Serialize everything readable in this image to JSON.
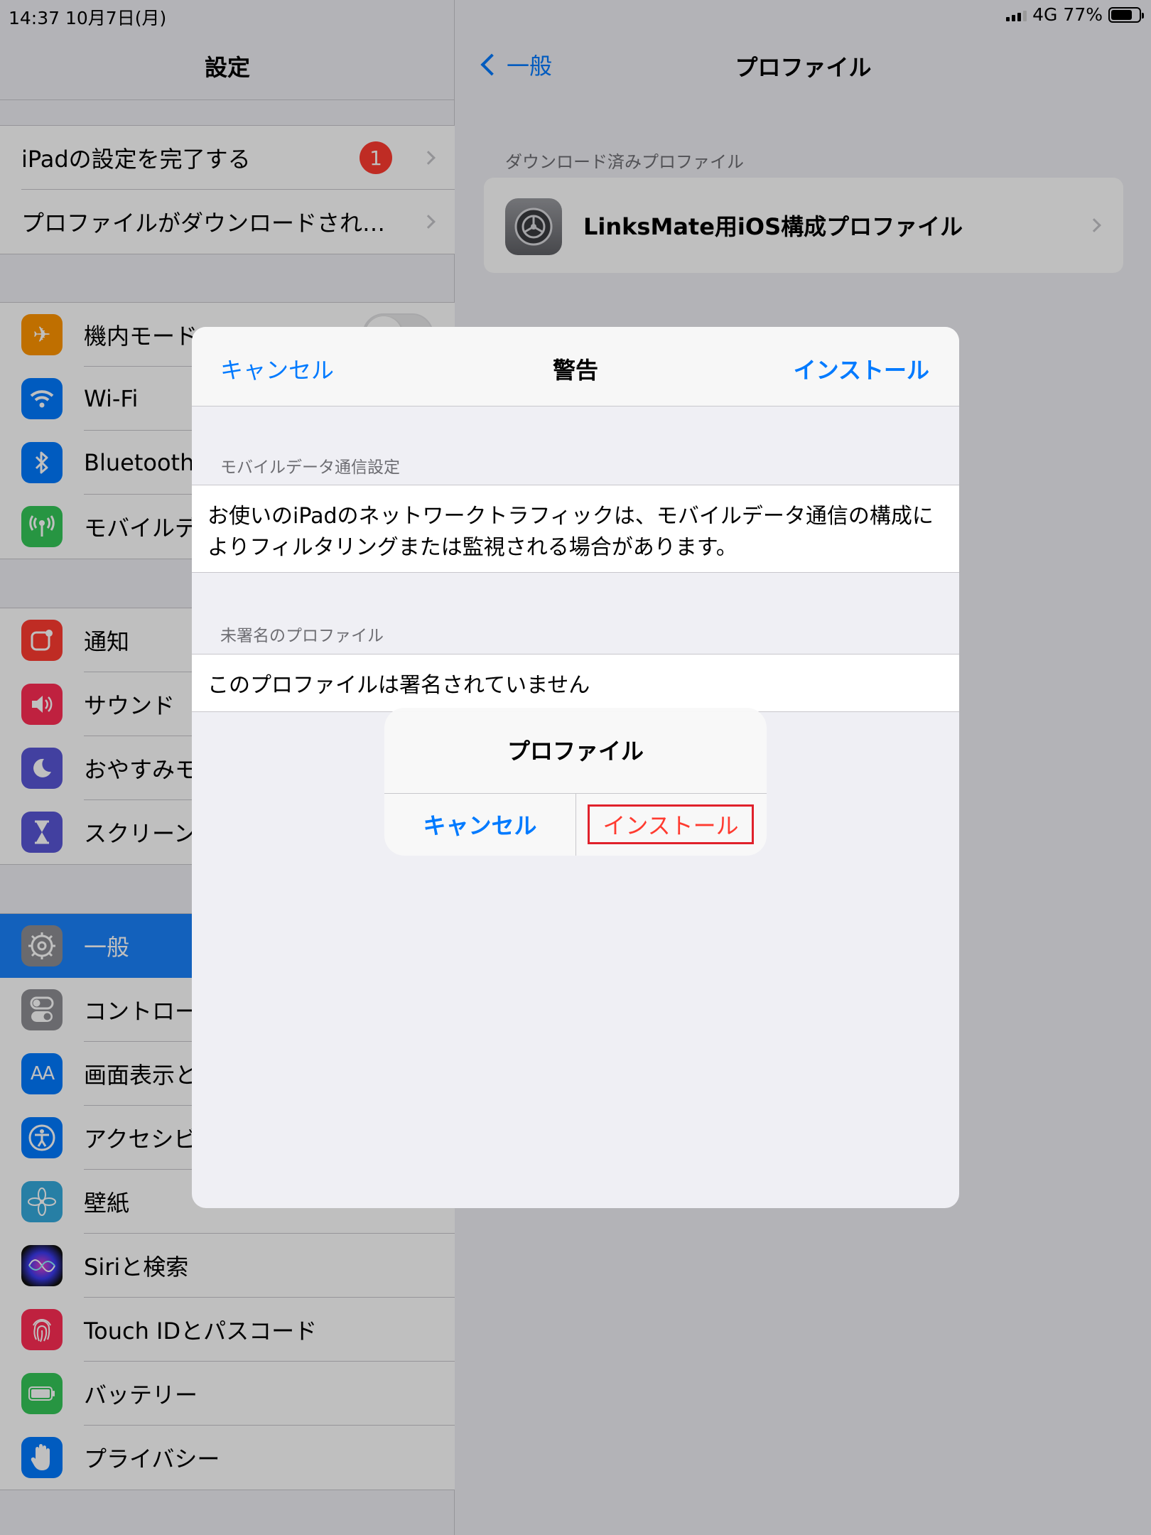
{
  "status_bar": {
    "time_date": "14:37  10月7日(月)",
    "network": "4G",
    "battery": "77%",
    "battery_level": 0.77
  },
  "sidebar": {
    "title": "設定",
    "setup_items": [
      {
        "label": "iPadの設定を完了する",
        "badge": "1"
      },
      {
        "label": "プロファイルがダウンロードされ…"
      }
    ],
    "group1": [
      {
        "label": "機内モード",
        "icon": "airplane-icon",
        "color": "#ff9500"
      },
      {
        "label": "Wi-Fi",
        "icon": "wifi-icon",
        "color": "#007aff"
      },
      {
        "label": "Bluetooth",
        "icon": "bluetooth-icon",
        "color": "#007aff"
      },
      {
        "label": "モバイルデ",
        "icon": "antenna-icon",
        "color": "#34c759"
      }
    ],
    "group2": [
      {
        "label": "通知",
        "icon": "notification-icon",
        "color": "#ff3b30"
      },
      {
        "label": "サウンド",
        "icon": "speaker-icon",
        "color": "#ff2d55"
      },
      {
        "label": "おやすみモ",
        "icon": "moon-icon",
        "color": "#5856d6"
      },
      {
        "label": "スクリーン",
        "icon": "hourglass-icon",
        "color": "#5856d6"
      }
    ],
    "group3": [
      {
        "label": "一般",
        "icon": "gear-icon",
        "color": "#8e8e93",
        "selected": true
      },
      {
        "label": "コントロー",
        "icon": "toggles-icon",
        "color": "#8e8e93"
      },
      {
        "label": "画面表示と",
        "icon": "text-size-icon",
        "color": "#007aff"
      },
      {
        "label": "アクセシビ",
        "icon": "accessibility-icon",
        "color": "#007aff"
      },
      {
        "label": "壁紙",
        "icon": "flower-icon",
        "color": "#34aadc"
      },
      {
        "label": "Siriと検索",
        "icon": "siri-icon",
        "color": "#222222"
      },
      {
        "label": "Touch IDとパスコード",
        "icon": "fingerprint-icon",
        "color": "#ff2d55"
      },
      {
        "label": "バッテリー",
        "icon": "battery-icon",
        "color": "#34c759"
      },
      {
        "label": "プライバシー",
        "icon": "hand-icon",
        "color": "#007aff"
      }
    ]
  },
  "detail": {
    "back_label": "一般",
    "title": "プロファイル",
    "section_header": "ダウンロード済みプロファイル",
    "profile_name": "LinksMate用iOS構成プロファイル"
  },
  "sheet": {
    "cancel": "キャンセル",
    "title": "警告",
    "install": "インストール",
    "section1_header": "モバイルデータ通信設定",
    "section1_text": "お使いのiPadのネットワークトラフィックは、モバイルデータ通信の構成によりフィルタリングまたは監視される場合があります。",
    "section2_header": "未署名のプロファイル",
    "section2_text": "このプロファイルは署名されていません"
  },
  "alert": {
    "title": "プロファイル",
    "cancel": "キャンセル",
    "install": "インストール"
  }
}
